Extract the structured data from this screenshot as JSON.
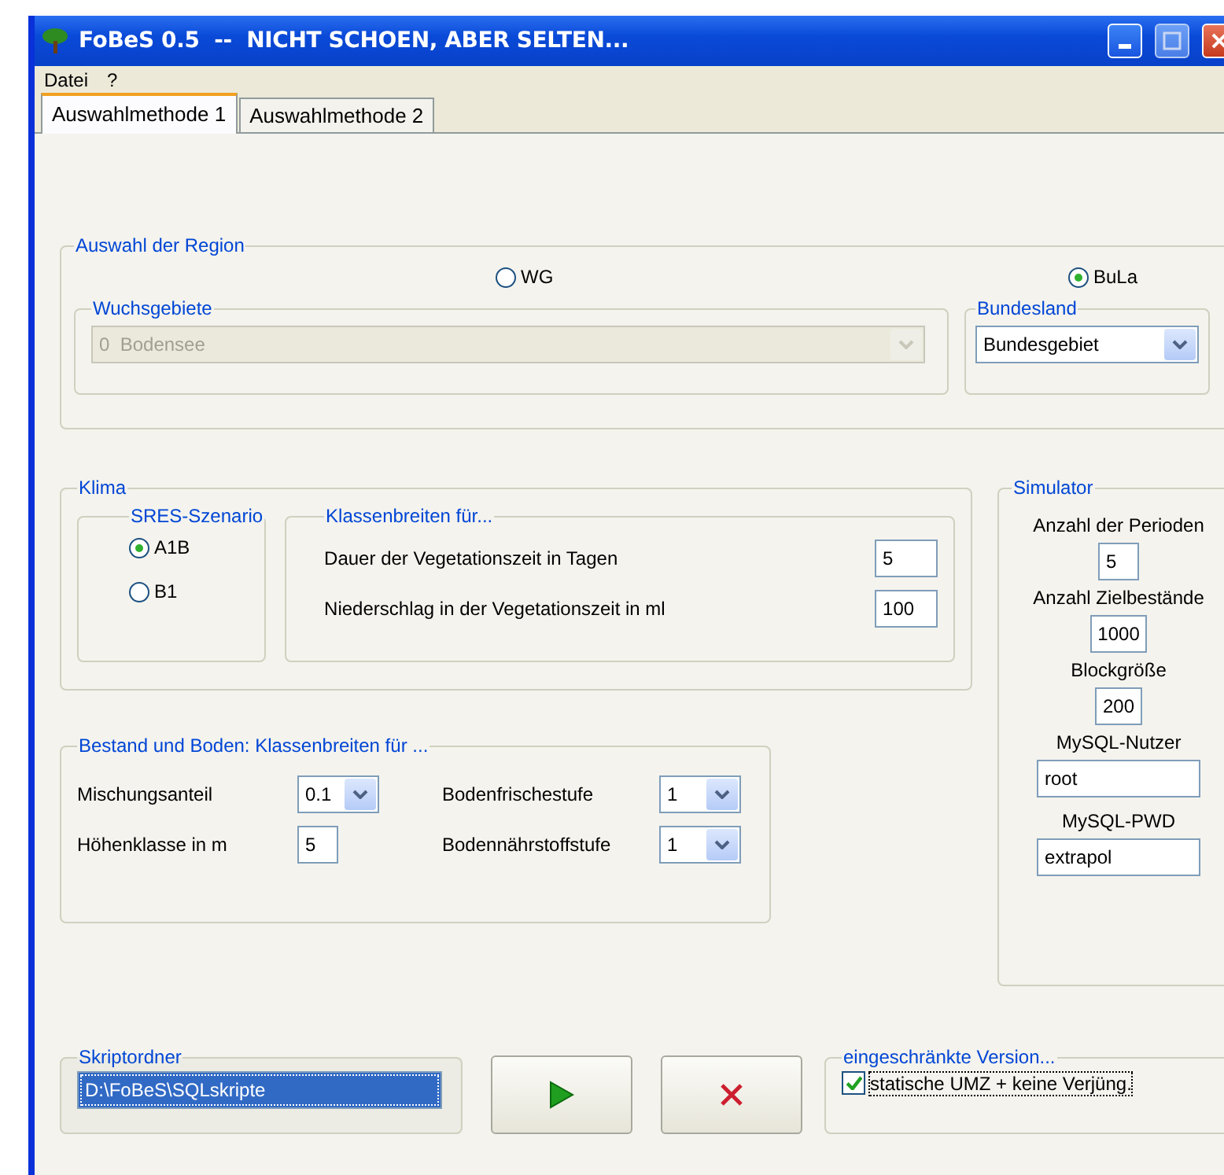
{
  "window": {
    "title": "FoBeS 0.5  --  NICHT SCHOEN, ABER SELTEN..."
  },
  "menu": [
    "Datei",
    "?"
  ],
  "tabs": [
    {
      "label": "Auswahlmethode 1",
      "selected": true
    },
    {
      "label": "Auswahlmethode 2",
      "selected": false
    }
  ],
  "region": {
    "title": "Auswahl der Region",
    "options": [
      {
        "label": "WG",
        "selected": false
      },
      {
        "label": "BuLa",
        "selected": true
      }
    ],
    "wuchsgebiete": {
      "title": "Wuchsgebiete",
      "value": "0  Bodensee",
      "disabled": true
    },
    "bundesland": {
      "title": "Bundesland",
      "value": "Bundesgebiet",
      "disabled": false
    }
  },
  "klima": {
    "title": "Klima",
    "sres": {
      "title": "SRES-Szenario",
      "options": [
        {
          "label": "A1B",
          "selected": true
        },
        {
          "label": "B1",
          "selected": false
        }
      ]
    },
    "klassen": {
      "title": "Klassenbreiten für...",
      "fields": [
        {
          "label": "Dauer der Vegetationszeit in Tagen",
          "value": "5"
        },
        {
          "label": "Niederschlag in der Vegetationszeit in ml",
          "value": "100"
        }
      ]
    }
  },
  "bestand": {
    "title": "Bestand und Boden: Klassenbreiten für ...",
    "fields": [
      {
        "label": "Mischungsanteil",
        "value": "0.1",
        "kind": "dropdown"
      },
      {
        "label": "Bodenfrischestufe",
        "value": "1",
        "kind": "dropdown"
      },
      {
        "label": "Höhenklasse in m",
        "value": "5",
        "kind": "text"
      },
      {
        "label": "Bodennährstoffstufe",
        "value": "1",
        "kind": "dropdown"
      }
    ]
  },
  "simulator": {
    "title": "Simulator",
    "fields": [
      {
        "label": "Anzahl der Perioden",
        "value": "5",
        "kind": "short"
      },
      {
        "label": "Anzahl Zielbestände",
        "value": "1000",
        "kind": "short"
      },
      {
        "label": "Blockgröße",
        "value": "200",
        "kind": "short"
      },
      {
        "label": "MySQL-Nutzer",
        "value": "root",
        "kind": "wide"
      },
      {
        "label": "MySQL-PWD",
        "value": "extrapol",
        "kind": "wide"
      }
    ]
  },
  "skript": {
    "title": "Skriptordner",
    "value": "D:\\FoBeS\\SQLskripte",
    "selected": true
  },
  "buttons": [
    {
      "kind": "run"
    },
    {
      "kind": "cancel"
    }
  ],
  "restricted": {
    "title": "eingeschränkte Version...",
    "checkbox": {
      "label": "statische UMZ + keine Verjüng.",
      "checked": true
    }
  }
}
